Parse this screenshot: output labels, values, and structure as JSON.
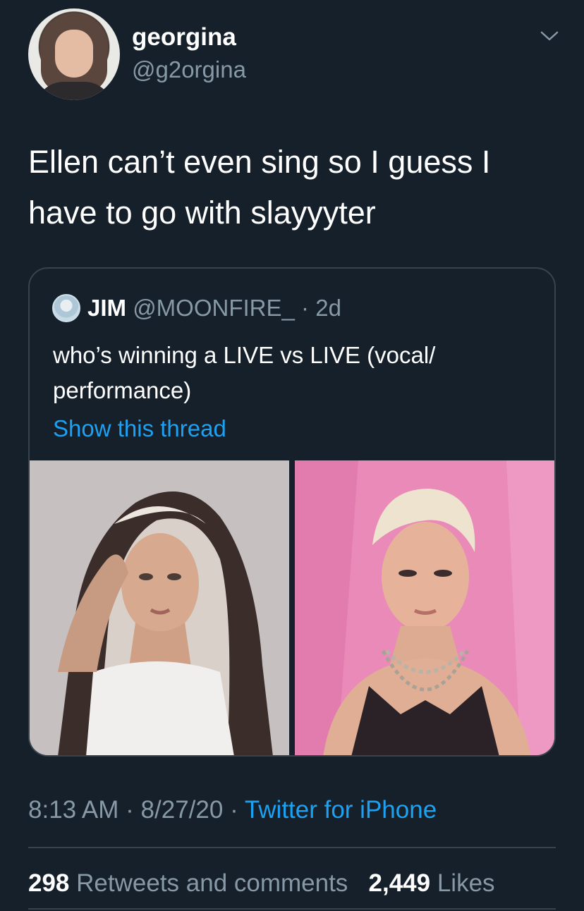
{
  "tweet": {
    "author": {
      "display_name": "georgina",
      "handle": "@g2orgina"
    },
    "text_line1": "Ellen can’t even sing so I guess I",
    "text_line2": "have to go with slayyyter",
    "quoted": {
      "name": "JIM",
      "handle": "@MOONFIRE_",
      "separator": "·",
      "age": "2d",
      "text_line1": "who’s winning a LIVE vs LIVE (vocal/",
      "text_line2": "performance)",
      "thread_link": "Show this thread"
    },
    "time": "8:13 AM",
    "date": "8/27/20",
    "dot": "·",
    "source": "Twitter for iPhone",
    "retweets_count": "298",
    "retweets_label": "Retweets and comments",
    "likes_count": "2,449",
    "likes_label": "Likes"
  },
  "icons": {
    "more": "chevron-down-icon"
  },
  "colors": {
    "background": "#15202b",
    "text": "#ffffff",
    "muted": "#8899a6",
    "accent": "#1da1f2",
    "border": "#38444d"
  }
}
